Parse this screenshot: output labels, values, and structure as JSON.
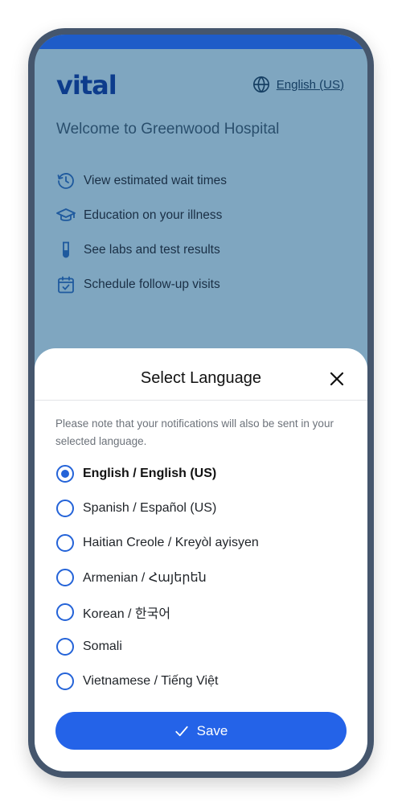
{
  "brand": {
    "logo": "vital"
  },
  "header": {
    "language_link": "English (US)",
    "language_icon": "globe-icon"
  },
  "welcome": {
    "title": "Welcome to Greenwood Hospital",
    "features": [
      {
        "icon": "clock-history-icon",
        "label": "View estimated wait times"
      },
      {
        "icon": "graduation-cap-icon",
        "label": "Education on your illness"
      },
      {
        "icon": "test-tube-icon",
        "label": "See labs and test results"
      },
      {
        "icon": "calendar-check-icon",
        "label": "Schedule follow-up visits"
      }
    ]
  },
  "modal": {
    "title": "Select Language",
    "close_icon": "close-icon",
    "note": "Please note that your notifications will also be sent in your selected language.",
    "options": [
      {
        "label": "English / English (US)",
        "selected": true
      },
      {
        "label": "Spanish / Español (US)",
        "selected": false
      },
      {
        "label": "Haitian Creole / Kreyòl ayisyen",
        "selected": false
      },
      {
        "label": "Armenian / Հայերեն",
        "selected": false
      },
      {
        "label": "Korean / 한국어",
        "selected": false
      },
      {
        "label": "Somali",
        "selected": false
      },
      {
        "label": "Vietnamese / Tiếng Việt",
        "selected": false
      }
    ],
    "save_label": "Save",
    "save_icon": "check-icon"
  },
  "colors": {
    "accent": "#2463E8",
    "header_bar": "#1E5CC8",
    "background_overlay": "#7FA6C0",
    "phone_frame": "#45566D"
  }
}
